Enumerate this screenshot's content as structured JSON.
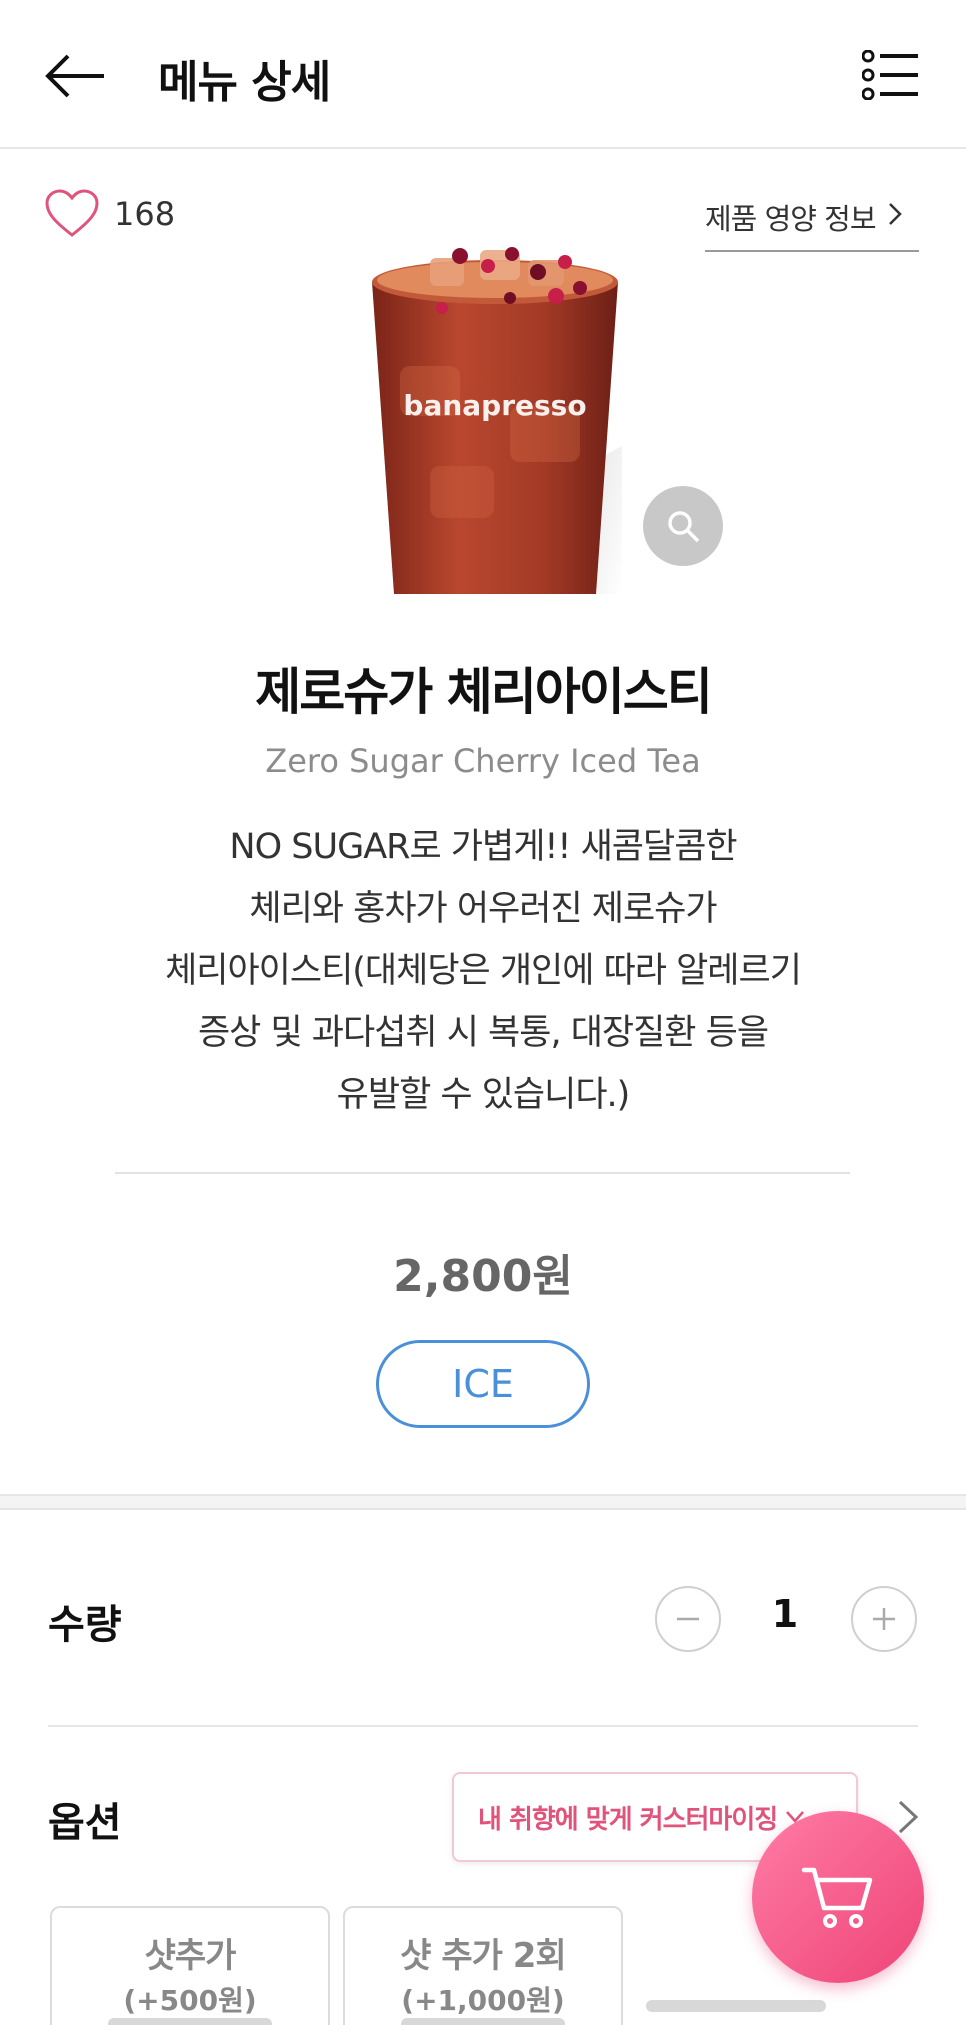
{
  "header": {
    "title": "메뉴 상세"
  },
  "like": {
    "count": "168"
  },
  "nutrition": {
    "label": "제품 영양 정보"
  },
  "product": {
    "image_brand_text": "banapresso",
    "name_ko": "제로슈가 체리아이스티",
    "name_en": "Zero Sugar Cherry Iced Tea",
    "description_lines": [
      "NO SUGAR로 가볍게!! 새콤달콤한",
      "체리와 홍차가 어우러진 제로슈가",
      "체리아이스티(대체당은 개인에 따라 알레르기",
      "증상 및 과다섭취 시 복통, 대장질환 등을",
      "유발할 수 있습니다.)"
    ],
    "price": "2,800원",
    "temperature": "ICE"
  },
  "quantity": {
    "label": "수량",
    "value": "1"
  },
  "options": {
    "label": "옵션",
    "customize_label": "내 취향에 맞게 커스터마이징",
    "items": [
      {
        "name": "샷추가",
        "price": "(+500원)"
      },
      {
        "name": "샷 추가 2회",
        "price": "(+1,000원)"
      }
    ]
  },
  "colors": {
    "accent_pink": "#ee4477",
    "ice_blue": "#4a90d9"
  },
  "icons": {
    "back": "arrow-left-icon",
    "menu": "list-icon",
    "like": "heart-icon",
    "zoom": "search-icon",
    "cart": "cart-icon"
  }
}
